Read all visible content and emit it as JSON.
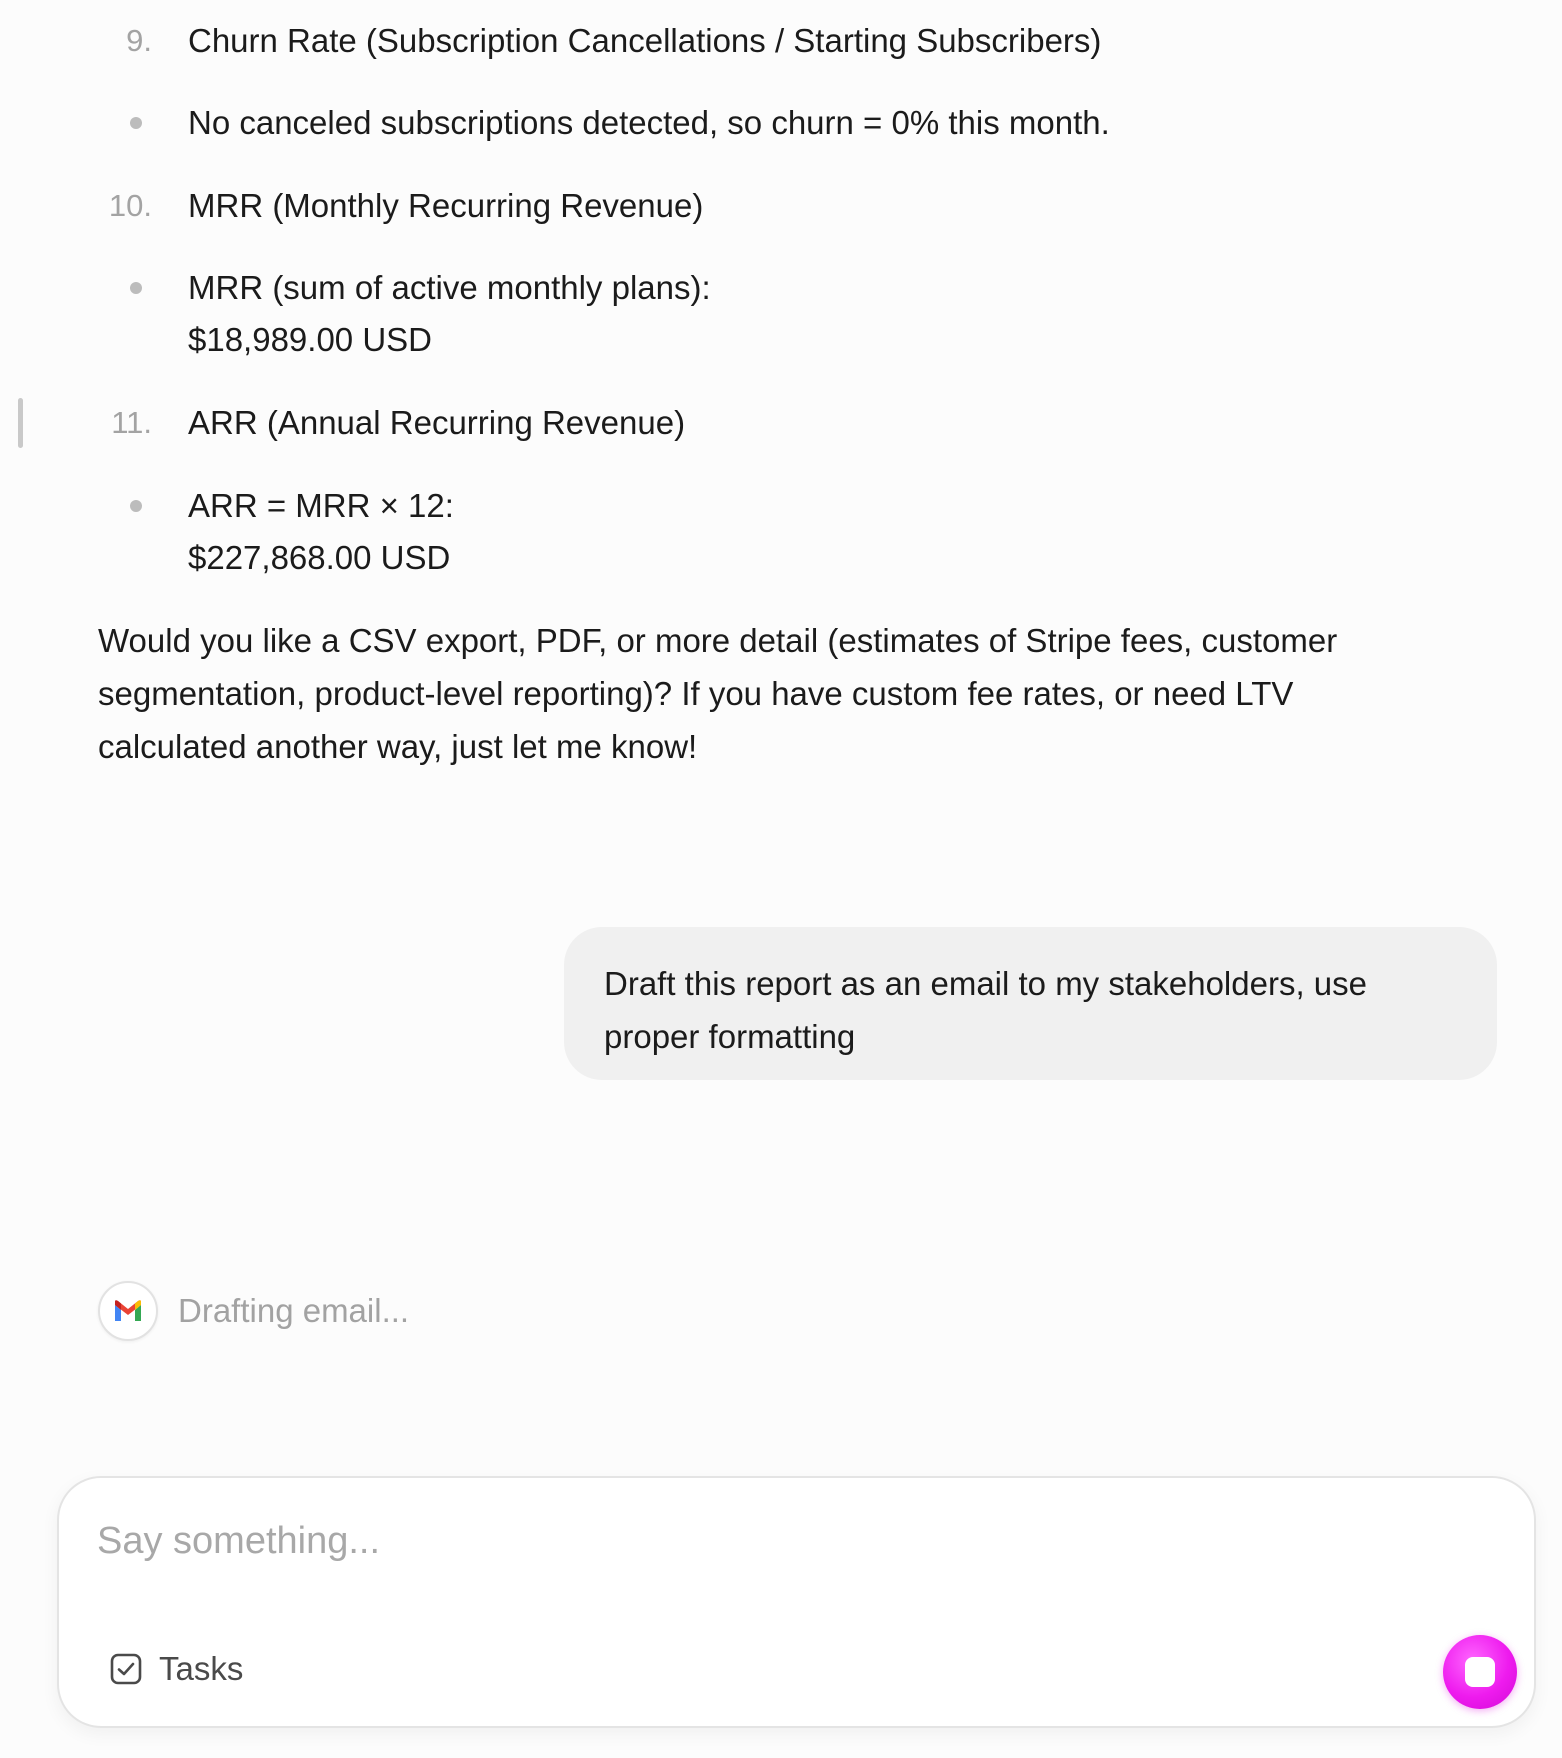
{
  "conversation": {
    "list_items": [
      {
        "marker": "9.",
        "text": "Churn Rate (Subscription Cancellations / Starting Subscribers)"
      },
      {
        "bullet": "No canceled subscriptions detected, so churn = 0% this month."
      },
      {
        "marker": "10.",
        "text": "MRR (Monthly Recurring Revenue)"
      },
      {
        "bullet_line1": "MRR (sum of active monthly plans):",
        "bullet_line2": "$18,989.00 USD"
      },
      {
        "marker": "11.",
        "text": "ARR (Annual Recurring Revenue)"
      },
      {
        "bullet_line1": "ARR = MRR × 12:",
        "bullet_line2": "$227,868.00 USD"
      }
    ],
    "follow_up": "Would you like a CSV export, PDF, or more detail (estimates of Stripe fees, customer segmentation, product-level reporting)? If you have custom fee rates, or need LTV calculated another way, just let me know!",
    "user_message": "Draft this report as an email to my stakeholders, use proper formatting",
    "tool_status": {
      "icon": "gmail-icon",
      "text": "Drafting email..."
    }
  },
  "composer": {
    "placeholder": "Say something...",
    "value": "",
    "tasks_label": "Tasks",
    "tasks_icon": "checkbox-icon",
    "stop_icon": "stop-icon"
  },
  "colors": {
    "background": "#fcfcfc",
    "user_bubble": "#f0f0f0",
    "stop_button": "#ee1bee",
    "muted_text": "#a2a2a2"
  }
}
